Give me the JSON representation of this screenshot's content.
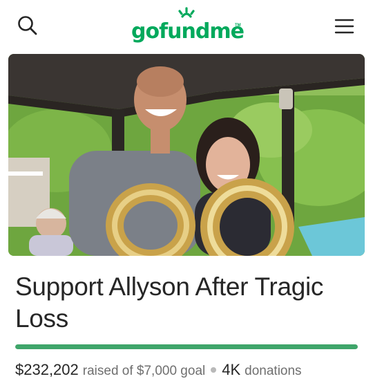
{
  "header": {
    "logo_text": "gofundme",
    "logo_tm": "TM",
    "search_icon": "search-icon",
    "menu_icon": "hamburger-menu-icon",
    "brand_color": "#02a95c"
  },
  "campaign": {
    "image_alt": "Campaign photo",
    "title": "Support Allyson After Tragic Loss",
    "raised_amount": "$232,202",
    "raised_label": "raised of $7,000 goal",
    "donation_count": "4K",
    "donation_label": "donations",
    "progress_fraction": 1.0,
    "progress_color": "#3fa56a"
  }
}
